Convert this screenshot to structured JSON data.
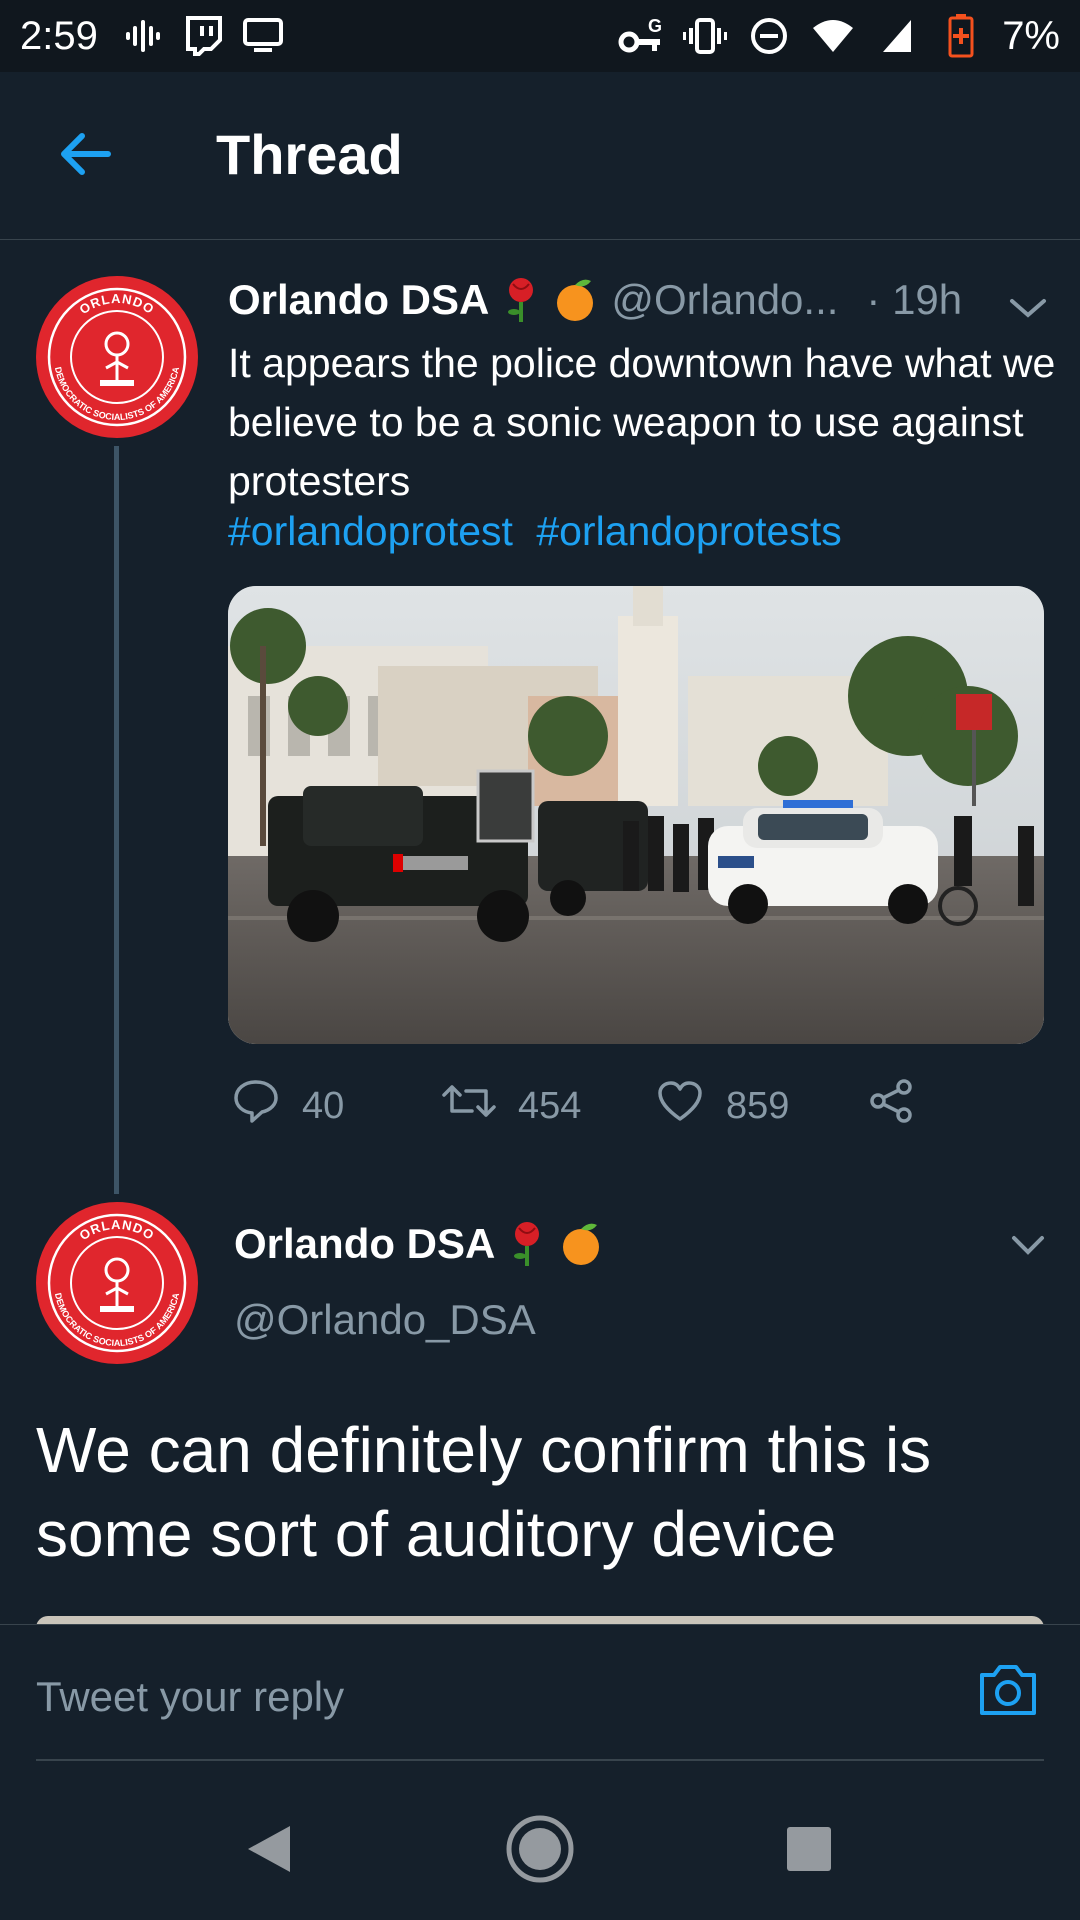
{
  "status_bar": {
    "time": "2:59",
    "battery_percent": "7%",
    "icons": [
      "podcast-icon",
      "twitch-icon",
      "cast-icon",
      "vpn-key-icon",
      "vibrate-icon",
      "do-not-disturb-icon",
      "wifi-icon",
      "cell-signal-icon",
      "battery-low-icon"
    ]
  },
  "header": {
    "title": "Thread",
    "back_icon": "back-arrow-icon"
  },
  "tweets": [
    {
      "author": "Orlando DSA",
      "emojis": [
        "rose-emoji",
        "orange-emoji"
      ],
      "handle": "@Orlando...",
      "time": "· 19h",
      "text": "It appears the police downtown have what we believe to be a sonic weapon to use against protesters",
      "hashtags": [
        "#orlandoprotest",
        "#orlandoprotests"
      ],
      "media": "photo-police-truck-street",
      "stats": {
        "replies": "40",
        "retweets": "454",
        "likes": "859"
      }
    },
    {
      "author": "Orlando DSA",
      "emojis": [
        "rose-emoji",
        "orange-emoji"
      ],
      "handle": "@Orlando_DSA",
      "text": "We can definitely confirm this is some sort of auditory device"
    }
  ],
  "avatar": {
    "ring_top": "ORLANDO",
    "ring_bottom": "DEMOCRATIC SOCIALISTS OF AMERICA"
  },
  "reply_bar": {
    "placeholder": "Tweet your reply"
  },
  "colors": {
    "background": "#15202b",
    "accent": "#1da1f2",
    "secondary_text": "#8899a6",
    "avatar_red": "#e0262d"
  }
}
